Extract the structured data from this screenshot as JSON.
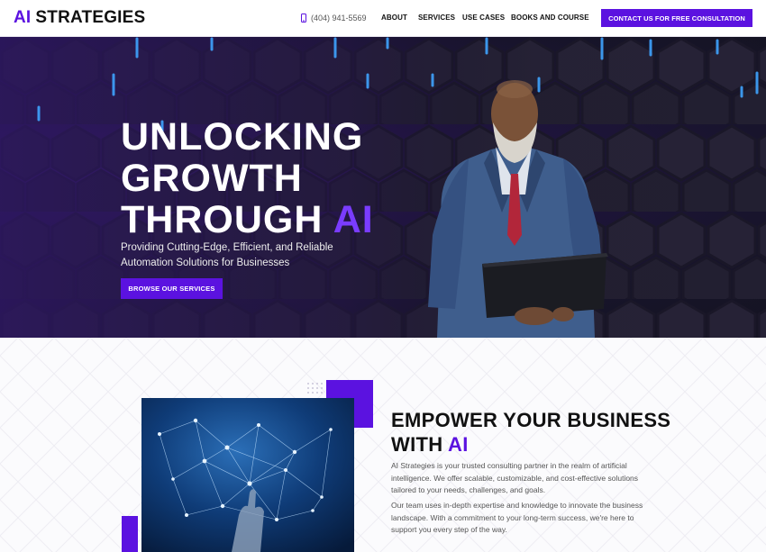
{
  "header": {
    "logo_ai": "AI",
    "logo_rest": "STRATEGIES",
    "phone": "(404) 941-5569",
    "nav": [
      "ABOUT",
      "SERVICES",
      "USE CASES",
      "BOOKS AND COURSE"
    ],
    "cta": "CONTACT US FOR FREE CONSULTATION"
  },
  "hero": {
    "line1": "UNLOCKING",
    "line2": "GROWTH",
    "line3_a": "THROUGH",
    "line3_b": "AI",
    "subtitle": "Providing Cutting-Edge, Efficient, and Reliable Automation Solutions for Businesses",
    "button": "BROWSE OUR SERVICES"
  },
  "about": {
    "title_line1": "EMPOWER YOUR BUSINESS",
    "title_line2_a": "WITH",
    "title_line2_b": "AI",
    "p1": "AI Strategies is your trusted consulting partner in the realm of artificial intelligence. We offer scalable, customizable, and cost-effective solutions tailored to your needs, challenges, and goals.",
    "p2": "Our team uses in-depth expertise and knowledge to innovate the business landscape. With a commitment to your long-term success, we're here to support you every step of the way."
  },
  "colors": {
    "accent": "#5b12e0",
    "hero_bg": "#1b1630",
    "light_accent": "#7a3cff"
  },
  "icons": {
    "phone": "phone-icon"
  }
}
